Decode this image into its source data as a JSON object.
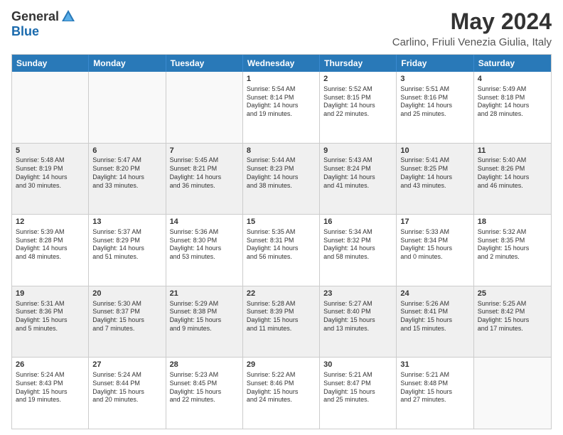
{
  "logo": {
    "general": "General",
    "blue": "Blue"
  },
  "title": "May 2024",
  "subtitle": "Carlino, Friuli Venezia Giulia, Italy",
  "headers": [
    "Sunday",
    "Monday",
    "Tuesday",
    "Wednesday",
    "Thursday",
    "Friday",
    "Saturday"
  ],
  "rows": [
    [
      {
        "num": "",
        "info": "",
        "empty": true
      },
      {
        "num": "",
        "info": "",
        "empty": true
      },
      {
        "num": "",
        "info": "",
        "empty": true
      },
      {
        "num": "1",
        "info": "Sunrise: 5:54 AM\nSunset: 8:14 PM\nDaylight: 14 hours\nand 19 minutes.",
        "empty": false
      },
      {
        "num": "2",
        "info": "Sunrise: 5:52 AM\nSunset: 8:15 PM\nDaylight: 14 hours\nand 22 minutes.",
        "empty": false
      },
      {
        "num": "3",
        "info": "Sunrise: 5:51 AM\nSunset: 8:16 PM\nDaylight: 14 hours\nand 25 minutes.",
        "empty": false
      },
      {
        "num": "4",
        "info": "Sunrise: 5:49 AM\nSunset: 8:18 PM\nDaylight: 14 hours\nand 28 minutes.",
        "empty": false
      }
    ],
    [
      {
        "num": "5",
        "info": "Sunrise: 5:48 AM\nSunset: 8:19 PM\nDaylight: 14 hours\nand 30 minutes.",
        "empty": false
      },
      {
        "num": "6",
        "info": "Sunrise: 5:47 AM\nSunset: 8:20 PM\nDaylight: 14 hours\nand 33 minutes.",
        "empty": false
      },
      {
        "num": "7",
        "info": "Sunrise: 5:45 AM\nSunset: 8:21 PM\nDaylight: 14 hours\nand 36 minutes.",
        "empty": false
      },
      {
        "num": "8",
        "info": "Sunrise: 5:44 AM\nSunset: 8:23 PM\nDaylight: 14 hours\nand 38 minutes.",
        "empty": false
      },
      {
        "num": "9",
        "info": "Sunrise: 5:43 AM\nSunset: 8:24 PM\nDaylight: 14 hours\nand 41 minutes.",
        "empty": false
      },
      {
        "num": "10",
        "info": "Sunrise: 5:41 AM\nSunset: 8:25 PM\nDaylight: 14 hours\nand 43 minutes.",
        "empty": false
      },
      {
        "num": "11",
        "info": "Sunrise: 5:40 AM\nSunset: 8:26 PM\nDaylight: 14 hours\nand 46 minutes.",
        "empty": false
      }
    ],
    [
      {
        "num": "12",
        "info": "Sunrise: 5:39 AM\nSunset: 8:28 PM\nDaylight: 14 hours\nand 48 minutes.",
        "empty": false
      },
      {
        "num": "13",
        "info": "Sunrise: 5:37 AM\nSunset: 8:29 PM\nDaylight: 14 hours\nand 51 minutes.",
        "empty": false
      },
      {
        "num": "14",
        "info": "Sunrise: 5:36 AM\nSunset: 8:30 PM\nDaylight: 14 hours\nand 53 minutes.",
        "empty": false
      },
      {
        "num": "15",
        "info": "Sunrise: 5:35 AM\nSunset: 8:31 PM\nDaylight: 14 hours\nand 56 minutes.",
        "empty": false
      },
      {
        "num": "16",
        "info": "Sunrise: 5:34 AM\nSunset: 8:32 PM\nDaylight: 14 hours\nand 58 minutes.",
        "empty": false
      },
      {
        "num": "17",
        "info": "Sunrise: 5:33 AM\nSunset: 8:34 PM\nDaylight: 15 hours\nand 0 minutes.",
        "empty": false
      },
      {
        "num": "18",
        "info": "Sunrise: 5:32 AM\nSunset: 8:35 PM\nDaylight: 15 hours\nand 2 minutes.",
        "empty": false
      }
    ],
    [
      {
        "num": "19",
        "info": "Sunrise: 5:31 AM\nSunset: 8:36 PM\nDaylight: 15 hours\nand 5 minutes.",
        "empty": false
      },
      {
        "num": "20",
        "info": "Sunrise: 5:30 AM\nSunset: 8:37 PM\nDaylight: 15 hours\nand 7 minutes.",
        "empty": false
      },
      {
        "num": "21",
        "info": "Sunrise: 5:29 AM\nSunset: 8:38 PM\nDaylight: 15 hours\nand 9 minutes.",
        "empty": false
      },
      {
        "num": "22",
        "info": "Sunrise: 5:28 AM\nSunset: 8:39 PM\nDaylight: 15 hours\nand 11 minutes.",
        "empty": false
      },
      {
        "num": "23",
        "info": "Sunrise: 5:27 AM\nSunset: 8:40 PM\nDaylight: 15 hours\nand 13 minutes.",
        "empty": false
      },
      {
        "num": "24",
        "info": "Sunrise: 5:26 AM\nSunset: 8:41 PM\nDaylight: 15 hours\nand 15 minutes.",
        "empty": false
      },
      {
        "num": "25",
        "info": "Sunrise: 5:25 AM\nSunset: 8:42 PM\nDaylight: 15 hours\nand 17 minutes.",
        "empty": false
      }
    ],
    [
      {
        "num": "26",
        "info": "Sunrise: 5:24 AM\nSunset: 8:43 PM\nDaylight: 15 hours\nand 19 minutes.",
        "empty": false
      },
      {
        "num": "27",
        "info": "Sunrise: 5:24 AM\nSunset: 8:44 PM\nDaylight: 15 hours\nand 20 minutes.",
        "empty": false
      },
      {
        "num": "28",
        "info": "Sunrise: 5:23 AM\nSunset: 8:45 PM\nDaylight: 15 hours\nand 22 minutes.",
        "empty": false
      },
      {
        "num": "29",
        "info": "Sunrise: 5:22 AM\nSunset: 8:46 PM\nDaylight: 15 hours\nand 24 minutes.",
        "empty": false
      },
      {
        "num": "30",
        "info": "Sunrise: 5:21 AM\nSunset: 8:47 PM\nDaylight: 15 hours\nand 25 minutes.",
        "empty": false
      },
      {
        "num": "31",
        "info": "Sunrise: 5:21 AM\nSunset: 8:48 PM\nDaylight: 15 hours\nand 27 minutes.",
        "empty": false
      },
      {
        "num": "",
        "info": "",
        "empty": true
      }
    ]
  ]
}
